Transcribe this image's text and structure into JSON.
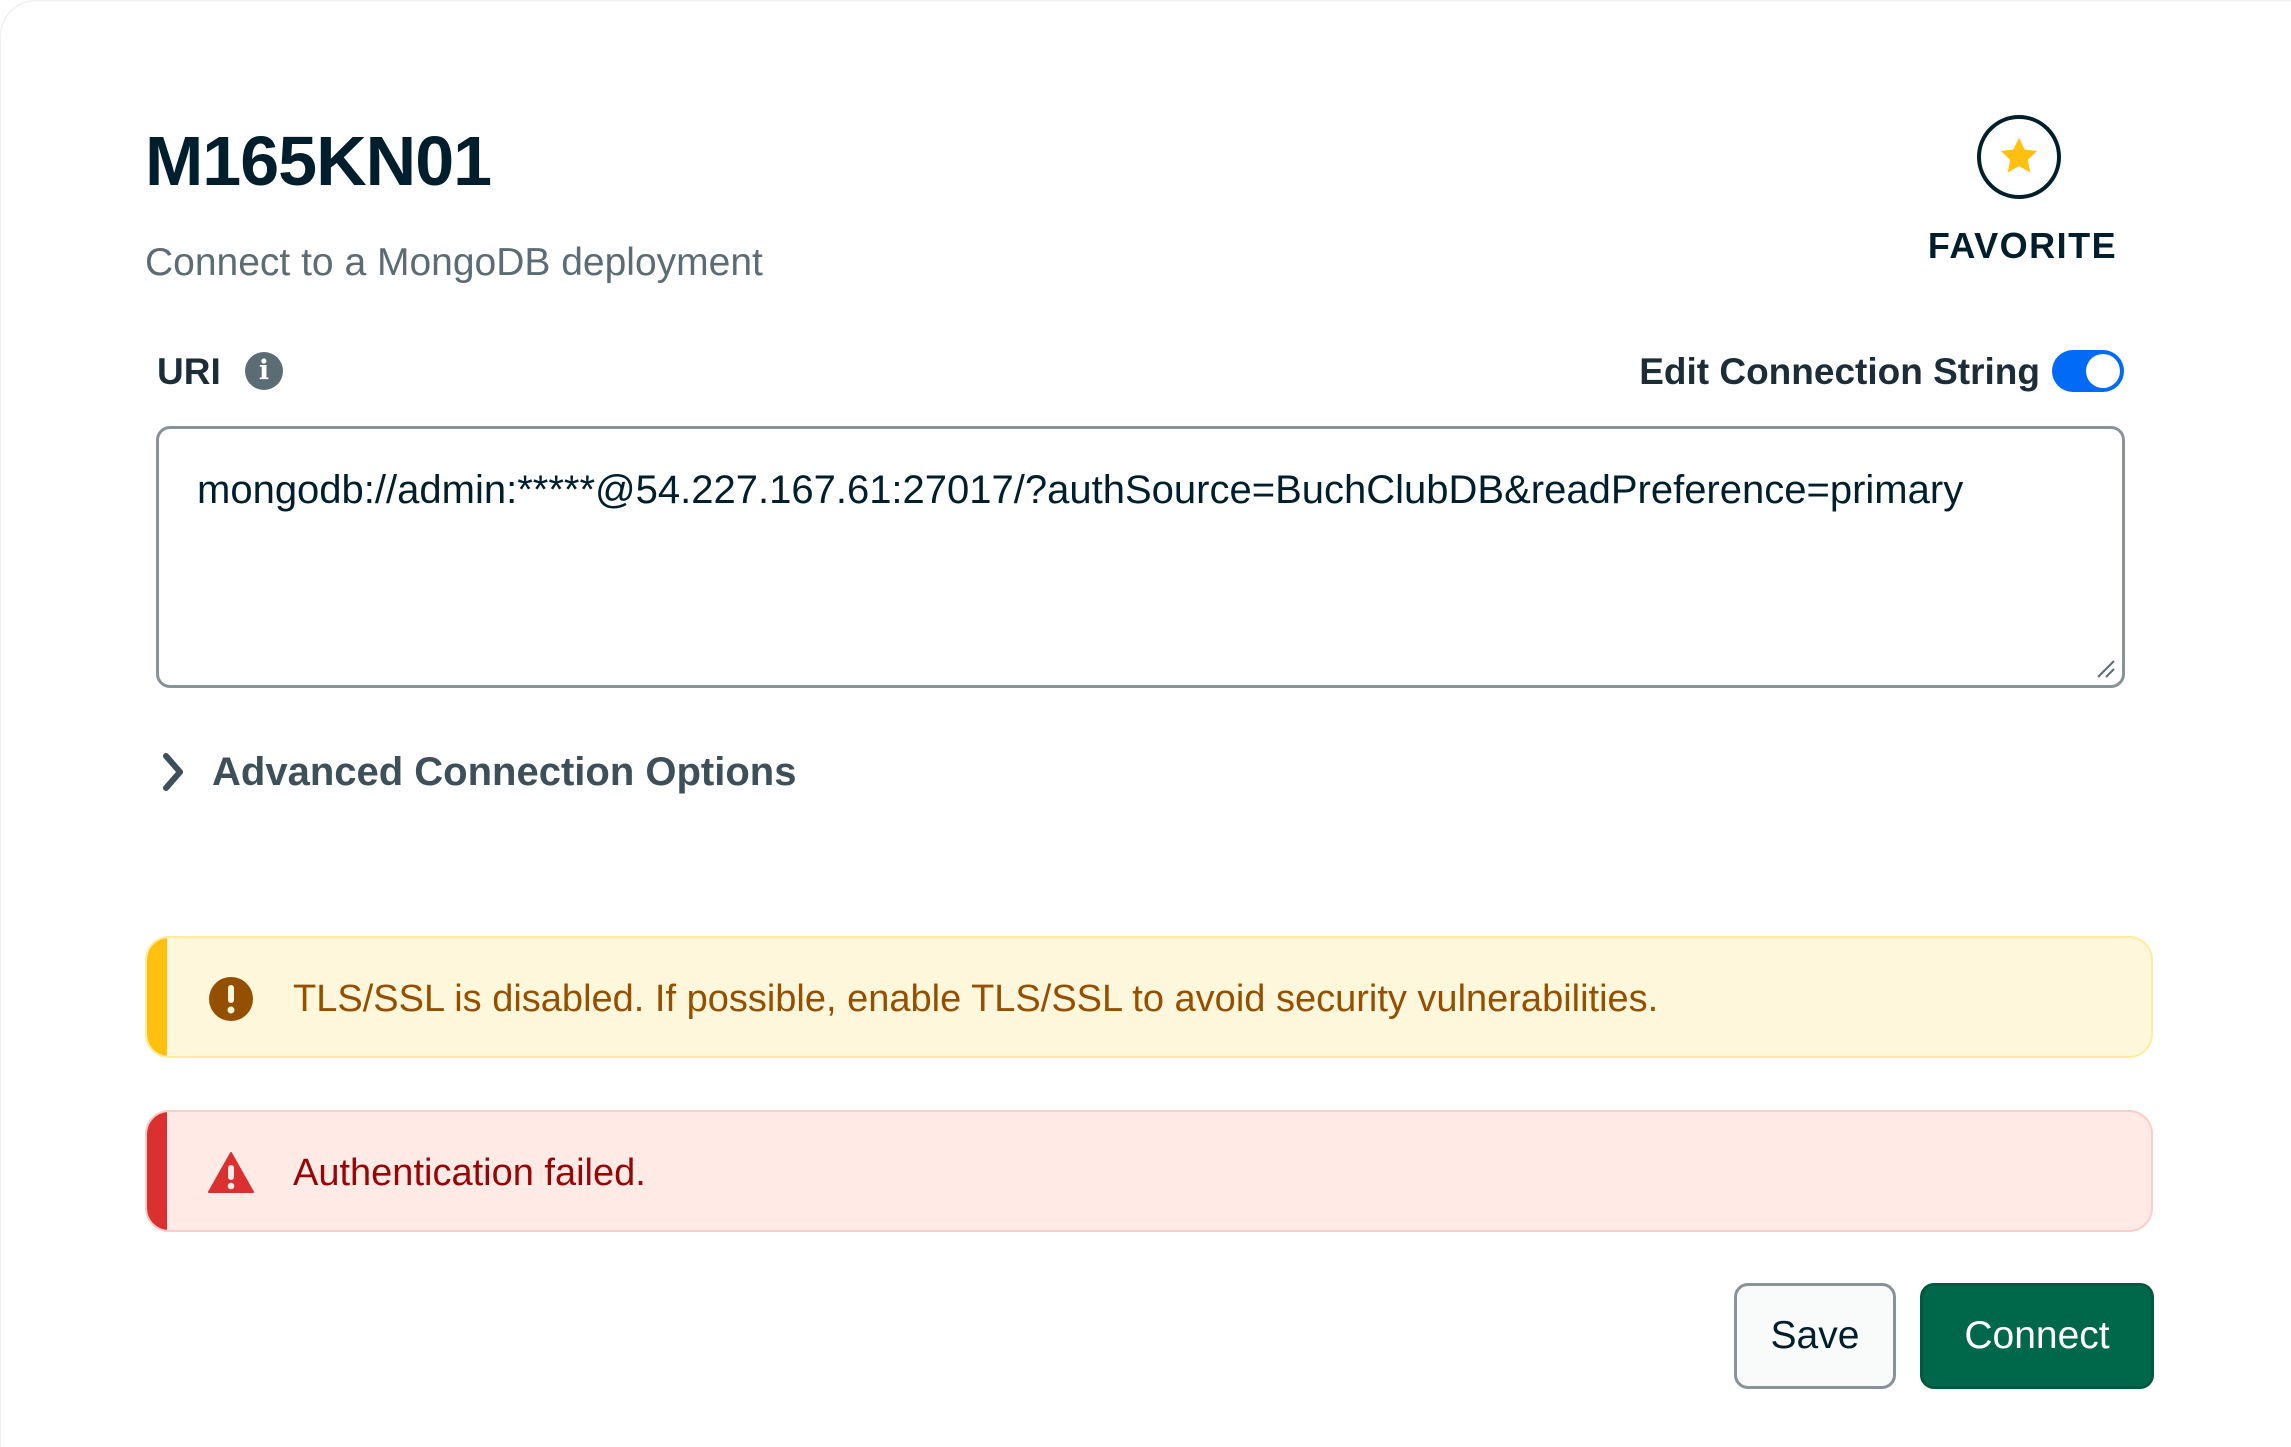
{
  "header": {
    "title": "M165KN01",
    "subtitle": "Connect to a MongoDB deployment",
    "favorite_label": "FAVORITE"
  },
  "uri_section": {
    "label": "URI",
    "info_icon": "info-icon",
    "edit_toggle_label": "Edit Connection String",
    "edit_toggle_on": true,
    "connection_string": "mongodb://admin:*****@54.227.167.61:27017/?authSource=BuchClubDB&readPreference=primary"
  },
  "advanced": {
    "label": "Advanced Connection Options",
    "icon": "chevron-right-icon"
  },
  "banners": {
    "warning": {
      "icon": "exclamation-circle-icon",
      "text": "TLS/SSL is disabled. If possible, enable TLS/SSL to avoid security vulnerabilities."
    },
    "error": {
      "icon": "warning-triangle-icon",
      "text": "Authentication failed."
    }
  },
  "actions": {
    "save_label": "Save",
    "connect_label": "Connect"
  },
  "colors": {
    "accent_blue": "#016bf8",
    "connect_green": "#00684a",
    "warning_bg": "#fef7db",
    "warning_stripe": "#ffc010",
    "error_bg": "#ffeae5",
    "error_stripe": "#db3030",
    "star_yellow": "#ffc010"
  }
}
